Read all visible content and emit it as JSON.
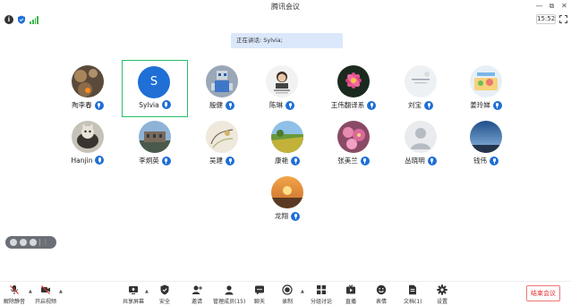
{
  "window": {
    "title": "腾讯会议",
    "ctrl_min": "—",
    "ctrl_max": "⧉",
    "ctrl_close": "✕"
  },
  "status": {
    "timer": "15:52",
    "info_symbol": "i"
  },
  "banner": {
    "text": "正在讲话: Sylvia;"
  },
  "participants": [
    {
      "name": "陶李春",
      "avatar": "bokeh-photo"
    },
    {
      "name": "Sylvia",
      "avatar": "letter",
      "initial": "S",
      "active": true
    },
    {
      "name": "殷健",
      "avatar": "robot-photo"
    },
    {
      "name": "陈琳",
      "avatar": "portrait-card"
    },
    {
      "name": "王伟翻译系",
      "avatar": "flower-photo"
    },
    {
      "name": "刘宝",
      "avatar": "text-card"
    },
    {
      "name": "姜玲娣",
      "avatar": "cartoon-photo"
    },
    {
      "name": "Hanjin",
      "avatar": "cat-photo"
    },
    {
      "name": "李炯英",
      "avatar": "building-photo"
    },
    {
      "name": "吴建",
      "avatar": "sketch-photo"
    },
    {
      "name": "康艳",
      "avatar": "field-photo"
    },
    {
      "name": "张美兰",
      "avatar": "pink-flower-photo"
    },
    {
      "name": "丛晓明",
      "avatar": "default-person"
    },
    {
      "name": "钱伟",
      "avatar": "sky-photo"
    },
    {
      "name": "龙翔",
      "avatar": "sunset-photo"
    }
  ],
  "float_tools": {
    "more": "⋮"
  },
  "toolbar": {
    "mute": "解除静音",
    "video": "开启视频",
    "share": "共享屏幕",
    "security": "安全",
    "invite": "邀请",
    "members": "管理成员(15)",
    "chat": "聊天",
    "record": "录制",
    "breakout": "分组讨论",
    "live": "直播",
    "reactions": "表情",
    "docs": "文档(1)",
    "settings": "设置",
    "end": "结束会议",
    "caret": "▲"
  }
}
